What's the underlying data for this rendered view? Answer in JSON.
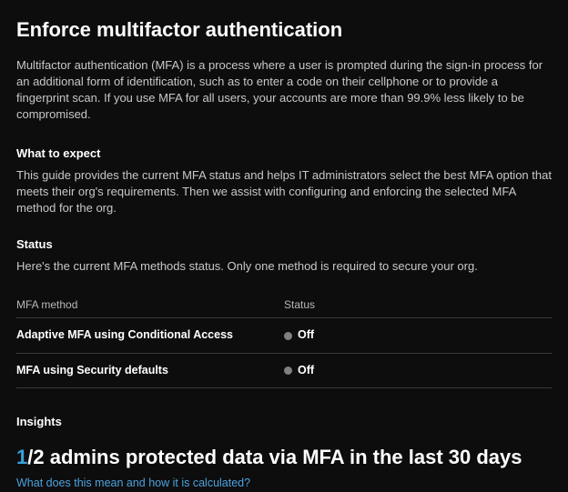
{
  "page": {
    "title": "Enforce multifactor authentication",
    "intro": "Multifactor authentication (MFA) is a process where a user is prompted during the sign-in process for an additional form of identification, such as to enter a code on their cellphone or to provide a fingerprint scan. If you use MFA for all users, your accounts are more than 99.9% less likely to be compromised."
  },
  "expect": {
    "label": "What to expect",
    "text": "This guide provides the current MFA status and helps IT administrators select the best MFA option that meets their org's requirements. Then we assist with configuring and enforcing the selected MFA method for the org."
  },
  "status": {
    "label": "Status",
    "desc": "Here's the current MFA methods status. Only one method is required to secure your org.",
    "columns": {
      "method": "MFA method",
      "status": "Status"
    },
    "rows": [
      {
        "method": "Adaptive MFA using Conditional Access",
        "state": "Off"
      },
      {
        "method": "MFA using Security defaults",
        "state": "Off"
      }
    ]
  },
  "insights": {
    "label": "Insights",
    "numerator": "1",
    "denom_and_text": "/2  admins protected data via MFA in the last 30 days",
    "link": "What does this mean and how it is calculated?"
  }
}
